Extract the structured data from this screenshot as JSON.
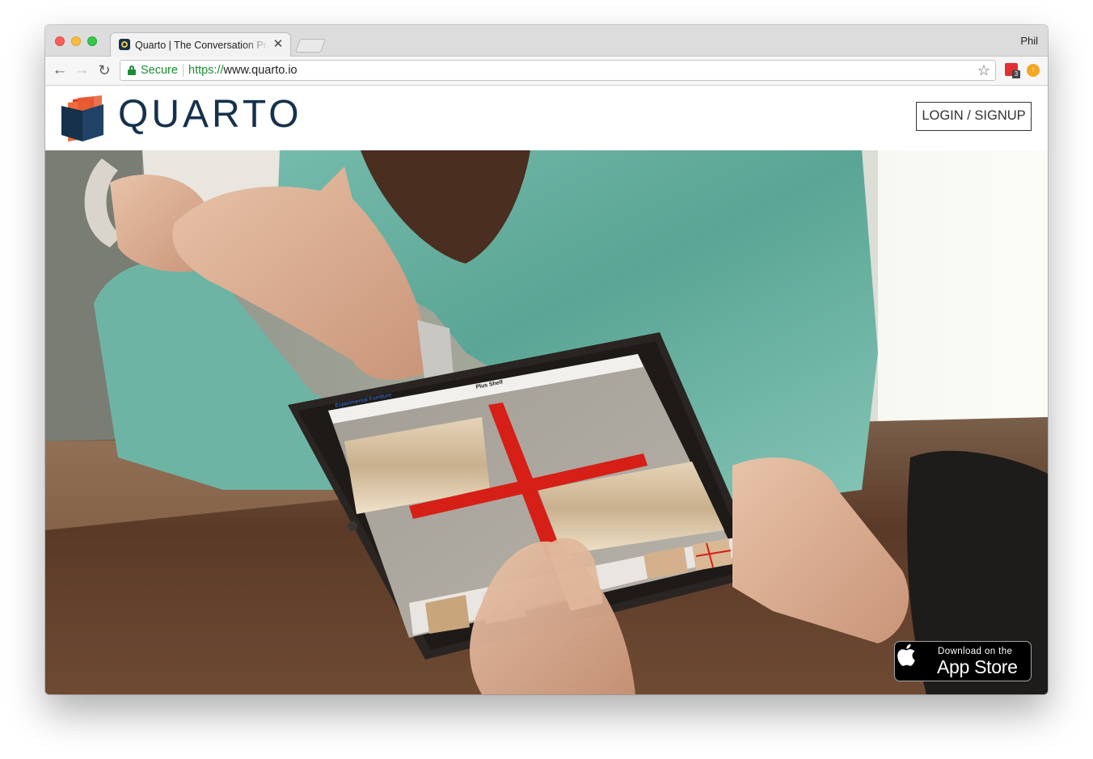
{
  "browser": {
    "tab_title": "Quarto | The Conversation Pre",
    "tab_close_glyph": "✕",
    "profile_name": "Phil",
    "secure_label": "Secure",
    "url_scheme": "https://",
    "url_host": "www.quarto.io",
    "extension_badge": "3"
  },
  "site": {
    "brand": "QUARTO",
    "login_button": "LOGIN / SIGNUP",
    "brand_colors": {
      "navy": "#16314c",
      "red": "#e23a2a",
      "orange": "#f26b3a"
    }
  },
  "tablet_screen": {
    "nav_back": "Experimental Furniture",
    "title": "Plus Shelf"
  },
  "appstore_badge": {
    "line1": "Download on the",
    "line2": "App Store"
  },
  "icons": {
    "back": "arrow-left-icon",
    "forward": "arrow-right-icon",
    "reload": "reload-icon",
    "star": "star-icon",
    "lock": "lock-icon",
    "apple": "apple-icon"
  }
}
